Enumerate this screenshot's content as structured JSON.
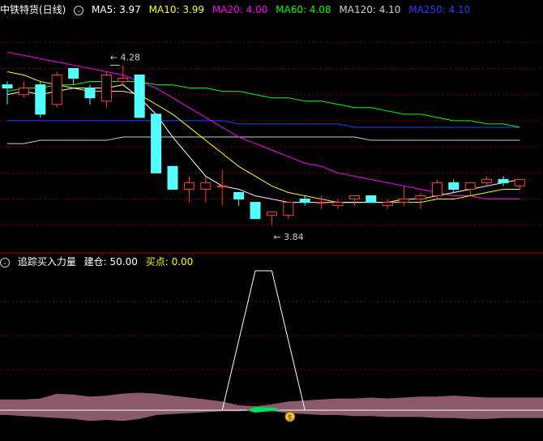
{
  "header_top": {
    "title": "中铁特货(日线)",
    "indicators": [
      {
        "label": "MA5: 3.97",
        "color": "#ffffff"
      },
      {
        "label": "MA10: 3.99",
        "color": "#ffff00"
      },
      {
        "label": "MA20: 4.00",
        "color": "#ff00ff"
      },
      {
        "label": "MA60: 4.08",
        "color": "#00ff00"
      },
      {
        "label": "MA120: 4.10",
        "color": "#d0d0d0"
      },
      {
        "label": "MA250: 4.10",
        "color": "#2040ff"
      }
    ]
  },
  "header_bottom": {
    "title": "追踪买入力量",
    "jiancang": "建仓: 50.00",
    "maidian": "买点: 0.00"
  },
  "annotations": {
    "high": "4.28",
    "low": "3.84"
  },
  "colors": {
    "up": "#ff3b3b",
    "down": "#54ffff",
    "grid": "#8b0000",
    "band": "#8a5a6a"
  },
  "chart_data": {
    "type": "candlestick",
    "ylim": [
      3.72,
      4.44
    ],
    "candles": [
      {
        "o": 4.23,
        "h": 4.24,
        "l": 4.17,
        "c": 4.22
      },
      {
        "o": 4.2,
        "h": 4.24,
        "l": 4.19,
        "c": 4.22
      },
      {
        "o": 4.23,
        "h": 4.24,
        "l": 4.13,
        "c": 4.14
      },
      {
        "o": 4.17,
        "h": 4.27,
        "l": 4.16,
        "c": 4.26
      },
      {
        "o": 4.28,
        "h": 4.28,
        "l": 4.23,
        "c": 4.25
      },
      {
        "o": 4.22,
        "h": 4.23,
        "l": 4.17,
        "c": 4.19
      },
      {
        "o": 4.18,
        "h": 4.27,
        "l": 4.16,
        "c": 4.26
      },
      {
        "o": 4.24,
        "h": 4.29,
        "l": 4.23,
        "c": 4.25
      },
      {
        "o": 4.26,
        "h": 4.26,
        "l": 4.14,
        "c": 4.13
      },
      {
        "o": 4.14,
        "h": 4.13,
        "l": 3.96,
        "c": 3.96
      },
      {
        "o": 3.98,
        "h": 3.97,
        "l": 3.91,
        "c": 3.91
      },
      {
        "o": 3.91,
        "h": 3.95,
        "l": 3.87,
        "c": 3.93
      },
      {
        "o": 3.91,
        "h": 3.95,
        "l": 3.87,
        "c": 3.93
      },
      {
        "o": 3.92,
        "h": 3.97,
        "l": 3.86,
        "c": 3.92
      },
      {
        "o": 3.9,
        "h": 3.9,
        "l": 3.86,
        "c": 3.88
      },
      {
        "o": 3.87,
        "h": 3.87,
        "l": 3.82,
        "c": 3.82
      },
      {
        "o": 3.83,
        "h": 3.84,
        "l": 3.8,
        "c": 3.84
      },
      {
        "o": 3.83,
        "h": 3.87,
        "l": 3.82,
        "c": 3.87
      },
      {
        "o": 3.88,
        "h": 3.89,
        "l": 3.86,
        "c": 3.87
      },
      {
        "o": 3.87,
        "h": 3.89,
        "l": 3.85,
        "c": 3.87
      },
      {
        "o": 3.86,
        "h": 3.88,
        "l": 3.85,
        "c": 3.87
      },
      {
        "o": 3.88,
        "h": 3.89,
        "l": 3.86,
        "c": 3.89
      },
      {
        "o": 3.89,
        "h": 3.89,
        "l": 3.87,
        "c": 3.87
      },
      {
        "o": 3.86,
        "h": 3.88,
        "l": 3.85,
        "c": 3.87
      },
      {
        "o": 3.87,
        "h": 3.92,
        "l": 3.86,
        "c": 3.88
      },
      {
        "o": 3.88,
        "h": 3.9,
        "l": 3.85,
        "c": 3.89
      },
      {
        "o": 3.89,
        "h": 3.94,
        "l": 3.88,
        "c": 3.93
      },
      {
        "o": 3.93,
        "h": 3.94,
        "l": 3.9,
        "c": 3.91
      },
      {
        "o": 3.91,
        "h": 3.93,
        "l": 3.89,
        "c": 3.93
      },
      {
        "o": 3.93,
        "h": 3.95,
        "l": 3.92,
        "c": 3.94
      },
      {
        "o": 3.94,
        "h": 3.95,
        "l": 3.92,
        "c": 3.93
      },
      {
        "o": 3.92,
        "h": 3.94,
        "l": 3.91,
        "c": 3.94
      }
    ],
    "ma5": [
      4.2,
      4.21,
      4.2,
      4.21,
      4.22,
      4.22,
      4.22,
      4.23,
      4.19,
      4.14,
      4.07,
      4.01,
      3.95,
      3.92,
      3.91,
      3.89,
      3.88,
      3.87,
      3.87,
      3.87,
      3.87,
      3.87,
      3.87,
      3.87,
      3.88,
      3.88,
      3.89,
      3.9,
      3.91,
      3.92,
      3.93,
      3.94
    ],
    "ma10": [
      4.27,
      4.26,
      4.24,
      4.23,
      4.22,
      4.21,
      4.21,
      4.21,
      4.2,
      4.17,
      4.14,
      4.1,
      4.06,
      4.02,
      3.98,
      3.95,
      3.92,
      3.9,
      3.89,
      3.88,
      3.87,
      3.87,
      3.87,
      3.87,
      3.87,
      3.87,
      3.88,
      3.88,
      3.89,
      3.9,
      3.91,
      3.91
    ],
    "ma20": [
      4.33,
      4.32,
      4.31,
      4.3,
      4.29,
      4.28,
      4.27,
      4.26,
      4.24,
      4.22,
      4.19,
      4.16,
      4.13,
      4.1,
      4.07,
      4.05,
      4.03,
      4.01,
      3.99,
      3.98,
      3.96,
      3.95,
      3.94,
      3.93,
      3.92,
      3.91,
      3.9,
      3.89,
      3.89,
      3.88,
      3.88,
      3.88
    ],
    "ma60": [
      4.21,
      4.22,
      4.22,
      4.23,
      4.23,
      4.24,
      4.24,
      4.24,
      4.24,
      4.23,
      4.23,
      4.22,
      4.22,
      4.21,
      4.21,
      4.2,
      4.19,
      4.19,
      4.18,
      4.18,
      4.17,
      4.16,
      4.16,
      4.15,
      4.14,
      4.14,
      4.13,
      4.12,
      4.12,
      4.11,
      4.11,
      4.1
    ],
    "ma120": [
      4.05,
      4.05,
      4.06,
      4.06,
      4.06,
      4.06,
      4.06,
      4.07,
      4.07,
      4.07,
      4.07,
      4.07,
      4.07,
      4.07,
      4.07,
      4.07,
      4.07,
      4.07,
      4.07,
      4.07,
      4.07,
      4.07,
      4.06,
      4.06,
      4.06,
      4.06,
      4.06,
      4.06,
      4.06,
      4.06,
      4.06,
      4.06
    ],
    "ma250": [
      4.12,
      4.12,
      4.12,
      4.12,
      4.12,
      4.12,
      4.12,
      4.12,
      4.12,
      4.12,
      4.12,
      4.12,
      4.12,
      4.12,
      4.11,
      4.11,
      4.11,
      4.11,
      4.11,
      4.11,
      4.11,
      4.1,
      4.1,
      4.1,
      4.1,
      4.1,
      4.1,
      4.1,
      4.1,
      4.1,
      4.1,
      4.1
    ],
    "indicator": {
      "ylim": [
        0,
        100
      ],
      "jiancang": [
        0,
        0,
        0,
        0,
        0,
        0,
        0,
        0,
        0,
        0,
        0,
        0,
        0,
        0,
        50,
        100,
        100,
        50,
        0,
        0,
        0,
        0,
        0,
        0,
        0,
        0,
        0,
        0,
        0,
        0,
        0,
        0
      ],
      "band_upper": [
        11,
        11,
        12,
        17,
        16,
        14,
        15,
        17,
        18,
        17,
        15,
        13,
        11,
        9,
        5,
        4,
        6,
        9,
        10,
        11,
        12,
        12,
        13,
        12,
        13,
        14,
        14,
        15,
        14,
        13,
        13,
        13
      ],
      "band_lower": [
        -5,
        -6,
        -7,
        -8,
        -9,
        -11,
        -10,
        -11,
        -9,
        -5,
        -4,
        -3,
        -2,
        -1,
        -1,
        0,
        -1,
        -3,
        -4,
        -5,
        -5,
        -6,
        -6,
        -7,
        -7,
        -7,
        -8,
        -8,
        -9,
        -9,
        -8,
        -8
      ],
      "band_mid": 0,
      "buy_marker_index": 17
    }
  }
}
